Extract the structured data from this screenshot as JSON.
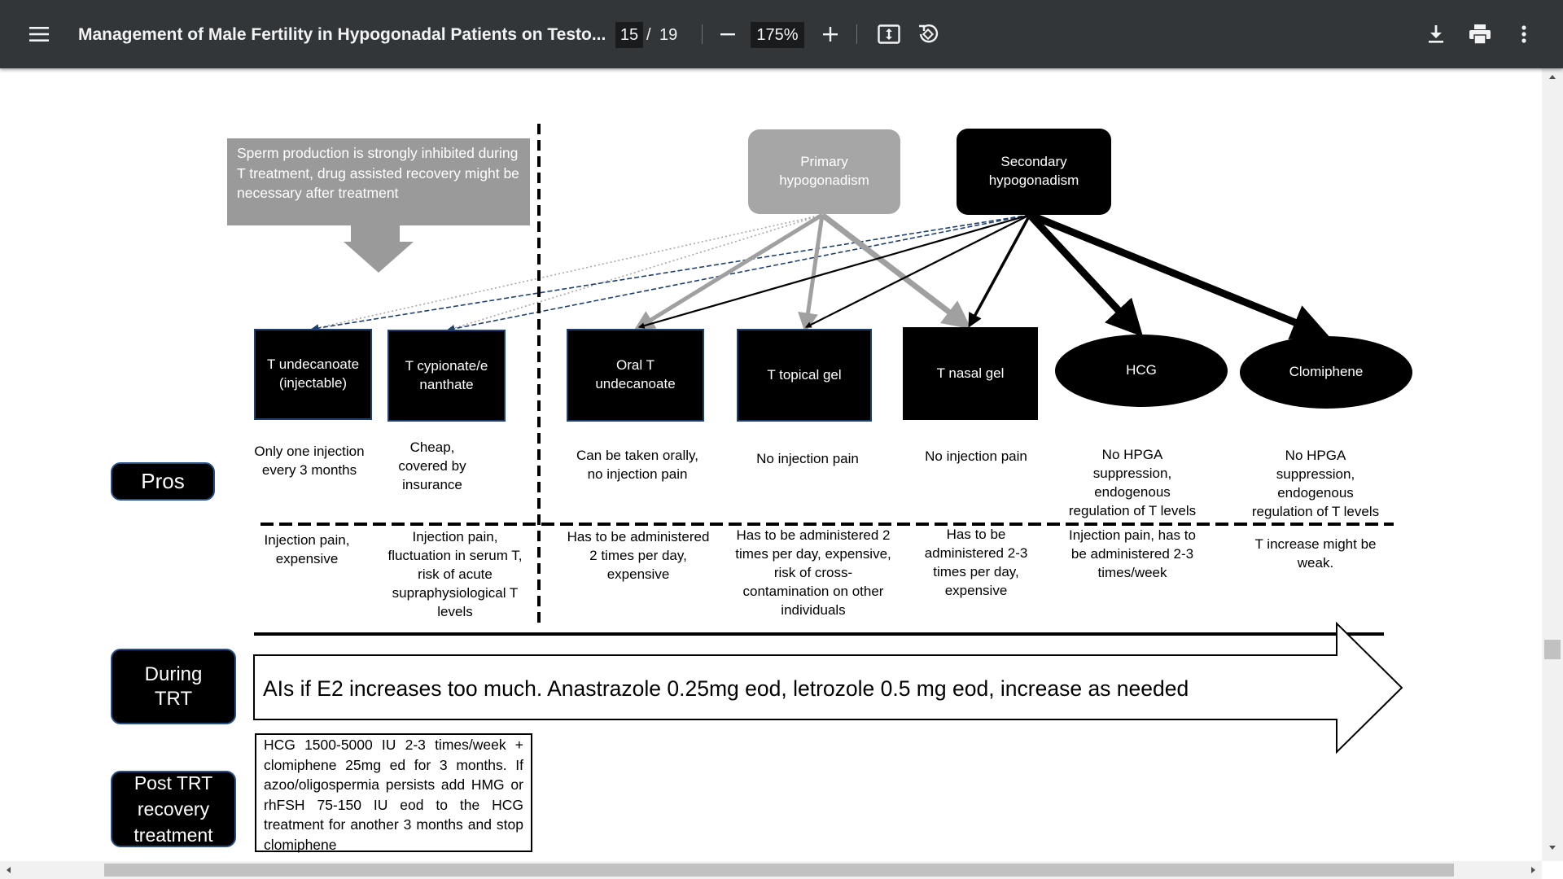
{
  "toolbar": {
    "title": "Management of Male Fertility in Hypogonadal Patients on Testo...",
    "current_page": "15",
    "page_separator": "/",
    "total_pages": "19",
    "zoom": "175%",
    "icons": [
      "menu-icon",
      "zoom-out-icon",
      "zoom-in-icon",
      "fit-page-icon",
      "rotate-icon",
      "download-icon",
      "print-icon",
      "more-vert-icon"
    ]
  },
  "figure": {
    "note": "Sperm production is strongly inhibited during T treatment, drug assisted recovery might be necessary after treatment",
    "primary": "Primary hypogonadism",
    "secondary": "Secondary hypogonadism",
    "treatments": [
      {
        "name": "T undecanoate (injectable)",
        "pros": "Only one injection every 3 months",
        "cons": "Injection pain, expensive"
      },
      {
        "name": "T cypionate/enanthate",
        "pros": "Cheap, covered by insurance",
        "cons": "Injection pain, fluctuation in serum T, risk of acute supraphysiological T levels"
      },
      {
        "name": "Oral T undecanoate",
        "pros": "Can be taken orally, no injection pain",
        "cons": "Has to be administered 2 times per day, expensive"
      },
      {
        "name": "T topical gel",
        "pros": "No injection pain",
        "cons": "Has to be administered 2 times per day, expensive, risk of cross-contamination on other individuals"
      },
      {
        "name": "T nasal gel",
        "pros": "No injection pain",
        "cons": "Has to be administered 2-3 times per day, expensive"
      },
      {
        "name": "HCG",
        "pros": "No HPGA suppression, endogenous regulation of T levels",
        "cons": "Injection pain, has to be administered 2-3 times/week"
      },
      {
        "name": "Clomiphene",
        "pros": "No HPGA suppression, endogenous regulation of T levels",
        "cons": "T increase might be weak."
      }
    ],
    "row_pros": "Pros",
    "row_during": "During TRT",
    "row_post": "Post TRT recovery treatment",
    "during_text": "AIs if E2 increases too much. Anastrazole 0.25mg eod, letrozole 0.5 mg eod, increase as needed",
    "post_text": "HCG 1500-5000 IU 2-3 times/week + clomiphene 25mg ed for 3 months. If azoo/oligospermia persists add HMG or rhFSH 75-150 IU eod to the HCG treatment for another 3 months and stop clomiphene"
  }
}
